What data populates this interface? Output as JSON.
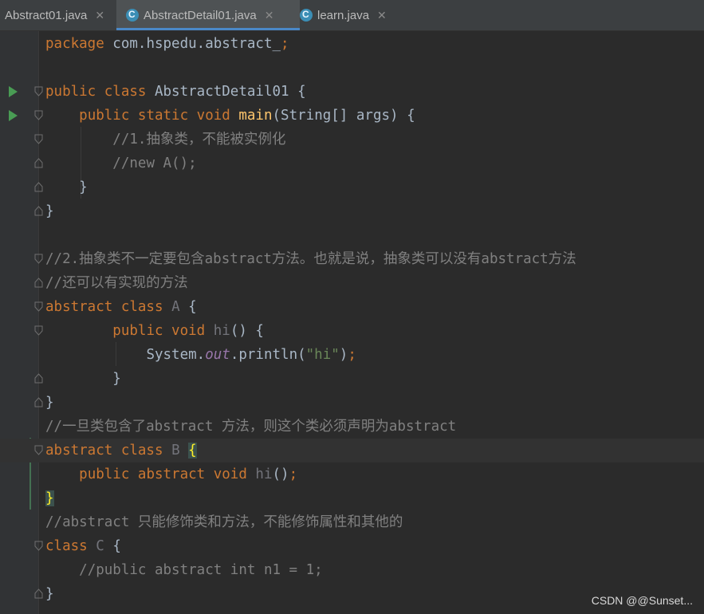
{
  "tabs": [
    {
      "label": "Abstract01.java",
      "active": false
    },
    {
      "label": "AbstractDetail01.java",
      "active": true
    },
    {
      "label": "learn.java",
      "active": false
    }
  ],
  "code_lines": [
    [
      "package com.hspedu.abstract_;"
    ],
    [
      ""
    ],
    [
      "public class AbstractDetail01 {"
    ],
    [
      "    public static void main(String[] args) {"
    ],
    [
      "        //1.抽象类，不能被实例化"
    ],
    [
      "        //new A();"
    ],
    [
      "    }"
    ],
    [
      "}"
    ],
    [
      ""
    ],
    [
      "//2.抽象类不一定要包含abstract方法。也就是说，抽象类可以没有abstract方法"
    ],
    [
      "//还可以有实现的方法"
    ],
    [
      "abstract class A {"
    ],
    [
      "        public void hi() {"
    ],
    [
      "            System.out.println(\"hi\");"
    ],
    [
      "        }"
    ],
    [
      "}"
    ],
    [
      "//一旦类包含了abstract 方法，则这个类必须声明为abstract"
    ],
    [
      "abstract class B {"
    ],
    [
      "    public abstract void hi();"
    ],
    [
      "}"
    ],
    [
      "//abstract 只能修饰类和方法，不能修饰属性和其他的"
    ],
    [
      "class C {"
    ],
    [
      "    //public abstract int n1 = 1;"
    ],
    [
      "}"
    ]
  ],
  "tokens": {
    "l0": [
      "package",
      " com.hspedu.abstract_",
      ";"
    ],
    "l2": [
      "public class",
      " AbstractDetail01 {"
    ],
    "l3a": "public static void",
    "l3b": "main",
    "l3c": "(String[] args) {",
    "l4": "//1.抽象类，不能被实例化",
    "l5": "//new A();",
    "l6": "}",
    "l7": "}",
    "l9": "//2.抽象类不一定要包含abstract方法。也就是说，抽象类可以没有abstract方法",
    "l10": "//还可以有实现的方法",
    "l11a": "abstract class",
    "l11b": "A",
    "l11c": "{",
    "l12a": "public void",
    "l12b": "hi",
    "l12c": "() {",
    "l13a": "System.",
    "l13b": "out",
    "l13c": ".println(",
    "l13d": "\"hi\"",
    "l13e": ")",
    "l13f": ";",
    "l14": "}",
    "l15": "}",
    "l16": "//一旦类包含了abstract 方法，则这个类必须声明为abstract",
    "l17a": "abstract class",
    "l17b": "B",
    "l17c": "{",
    "l18a": "public abstract void",
    "l18b": "hi",
    "l18c": "()",
    "l18d": ";",
    "l19": "}",
    "l20": "//abstract 只能修饰类和方法，不能修饰属性和其他的",
    "l21a": "class",
    "l21b": "C",
    "l21c": "{",
    "l22": "//public abstract int n1 = 1;",
    "l23": "}"
  },
  "watermark": "CSDN @@Sunset...",
  "colors": {
    "background": "#2b2b2b",
    "keyword": "#cc7832",
    "method": "#ffc66d",
    "comment": "#808080",
    "string": "#6a8759",
    "static_field": "#9876aa",
    "run_icon": "#499c54"
  },
  "icons": {
    "run": "run-gutter-icon",
    "fold": "fold-marker-icon",
    "java_class": "java-class-icon"
  }
}
